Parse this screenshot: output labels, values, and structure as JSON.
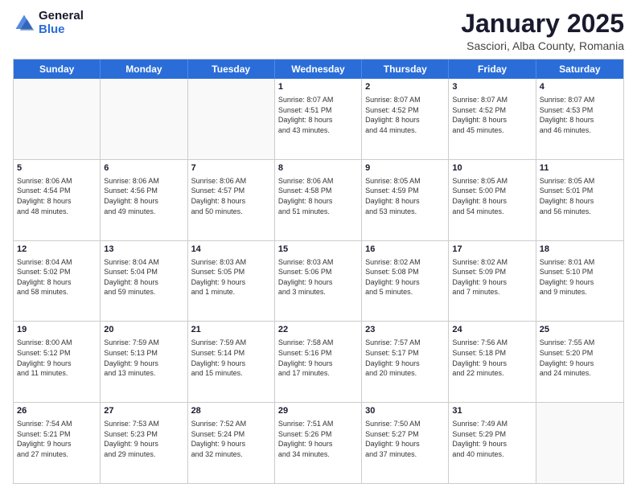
{
  "logo": {
    "general": "General",
    "blue": "Blue"
  },
  "header": {
    "month": "January 2025",
    "location": "Sasciori, Alba County, Romania"
  },
  "weekdays": [
    "Sunday",
    "Monday",
    "Tuesday",
    "Wednesday",
    "Thursday",
    "Friday",
    "Saturday"
  ],
  "weeks": [
    [
      {
        "day": "",
        "info": ""
      },
      {
        "day": "",
        "info": ""
      },
      {
        "day": "",
        "info": ""
      },
      {
        "day": "1",
        "info": "Sunrise: 8:07 AM\nSunset: 4:51 PM\nDaylight: 8 hours\nand 43 minutes."
      },
      {
        "day": "2",
        "info": "Sunrise: 8:07 AM\nSunset: 4:52 PM\nDaylight: 8 hours\nand 44 minutes."
      },
      {
        "day": "3",
        "info": "Sunrise: 8:07 AM\nSunset: 4:52 PM\nDaylight: 8 hours\nand 45 minutes."
      },
      {
        "day": "4",
        "info": "Sunrise: 8:07 AM\nSunset: 4:53 PM\nDaylight: 8 hours\nand 46 minutes."
      }
    ],
    [
      {
        "day": "5",
        "info": "Sunrise: 8:06 AM\nSunset: 4:54 PM\nDaylight: 8 hours\nand 48 minutes."
      },
      {
        "day": "6",
        "info": "Sunrise: 8:06 AM\nSunset: 4:56 PM\nDaylight: 8 hours\nand 49 minutes."
      },
      {
        "day": "7",
        "info": "Sunrise: 8:06 AM\nSunset: 4:57 PM\nDaylight: 8 hours\nand 50 minutes."
      },
      {
        "day": "8",
        "info": "Sunrise: 8:06 AM\nSunset: 4:58 PM\nDaylight: 8 hours\nand 51 minutes."
      },
      {
        "day": "9",
        "info": "Sunrise: 8:05 AM\nSunset: 4:59 PM\nDaylight: 8 hours\nand 53 minutes."
      },
      {
        "day": "10",
        "info": "Sunrise: 8:05 AM\nSunset: 5:00 PM\nDaylight: 8 hours\nand 54 minutes."
      },
      {
        "day": "11",
        "info": "Sunrise: 8:05 AM\nSunset: 5:01 PM\nDaylight: 8 hours\nand 56 minutes."
      }
    ],
    [
      {
        "day": "12",
        "info": "Sunrise: 8:04 AM\nSunset: 5:02 PM\nDaylight: 8 hours\nand 58 minutes."
      },
      {
        "day": "13",
        "info": "Sunrise: 8:04 AM\nSunset: 5:04 PM\nDaylight: 8 hours\nand 59 minutes."
      },
      {
        "day": "14",
        "info": "Sunrise: 8:03 AM\nSunset: 5:05 PM\nDaylight: 9 hours\nand 1 minute."
      },
      {
        "day": "15",
        "info": "Sunrise: 8:03 AM\nSunset: 5:06 PM\nDaylight: 9 hours\nand 3 minutes."
      },
      {
        "day": "16",
        "info": "Sunrise: 8:02 AM\nSunset: 5:08 PM\nDaylight: 9 hours\nand 5 minutes."
      },
      {
        "day": "17",
        "info": "Sunrise: 8:02 AM\nSunset: 5:09 PM\nDaylight: 9 hours\nand 7 minutes."
      },
      {
        "day": "18",
        "info": "Sunrise: 8:01 AM\nSunset: 5:10 PM\nDaylight: 9 hours\nand 9 minutes."
      }
    ],
    [
      {
        "day": "19",
        "info": "Sunrise: 8:00 AM\nSunset: 5:12 PM\nDaylight: 9 hours\nand 11 minutes."
      },
      {
        "day": "20",
        "info": "Sunrise: 7:59 AM\nSunset: 5:13 PM\nDaylight: 9 hours\nand 13 minutes."
      },
      {
        "day": "21",
        "info": "Sunrise: 7:59 AM\nSunset: 5:14 PM\nDaylight: 9 hours\nand 15 minutes."
      },
      {
        "day": "22",
        "info": "Sunrise: 7:58 AM\nSunset: 5:16 PM\nDaylight: 9 hours\nand 17 minutes."
      },
      {
        "day": "23",
        "info": "Sunrise: 7:57 AM\nSunset: 5:17 PM\nDaylight: 9 hours\nand 20 minutes."
      },
      {
        "day": "24",
        "info": "Sunrise: 7:56 AM\nSunset: 5:18 PM\nDaylight: 9 hours\nand 22 minutes."
      },
      {
        "day": "25",
        "info": "Sunrise: 7:55 AM\nSunset: 5:20 PM\nDaylight: 9 hours\nand 24 minutes."
      }
    ],
    [
      {
        "day": "26",
        "info": "Sunrise: 7:54 AM\nSunset: 5:21 PM\nDaylight: 9 hours\nand 27 minutes."
      },
      {
        "day": "27",
        "info": "Sunrise: 7:53 AM\nSunset: 5:23 PM\nDaylight: 9 hours\nand 29 minutes."
      },
      {
        "day": "28",
        "info": "Sunrise: 7:52 AM\nSunset: 5:24 PM\nDaylight: 9 hours\nand 32 minutes."
      },
      {
        "day": "29",
        "info": "Sunrise: 7:51 AM\nSunset: 5:26 PM\nDaylight: 9 hours\nand 34 minutes."
      },
      {
        "day": "30",
        "info": "Sunrise: 7:50 AM\nSunset: 5:27 PM\nDaylight: 9 hours\nand 37 minutes."
      },
      {
        "day": "31",
        "info": "Sunrise: 7:49 AM\nSunset: 5:29 PM\nDaylight: 9 hours\nand 40 minutes."
      },
      {
        "day": "",
        "info": ""
      }
    ]
  ]
}
